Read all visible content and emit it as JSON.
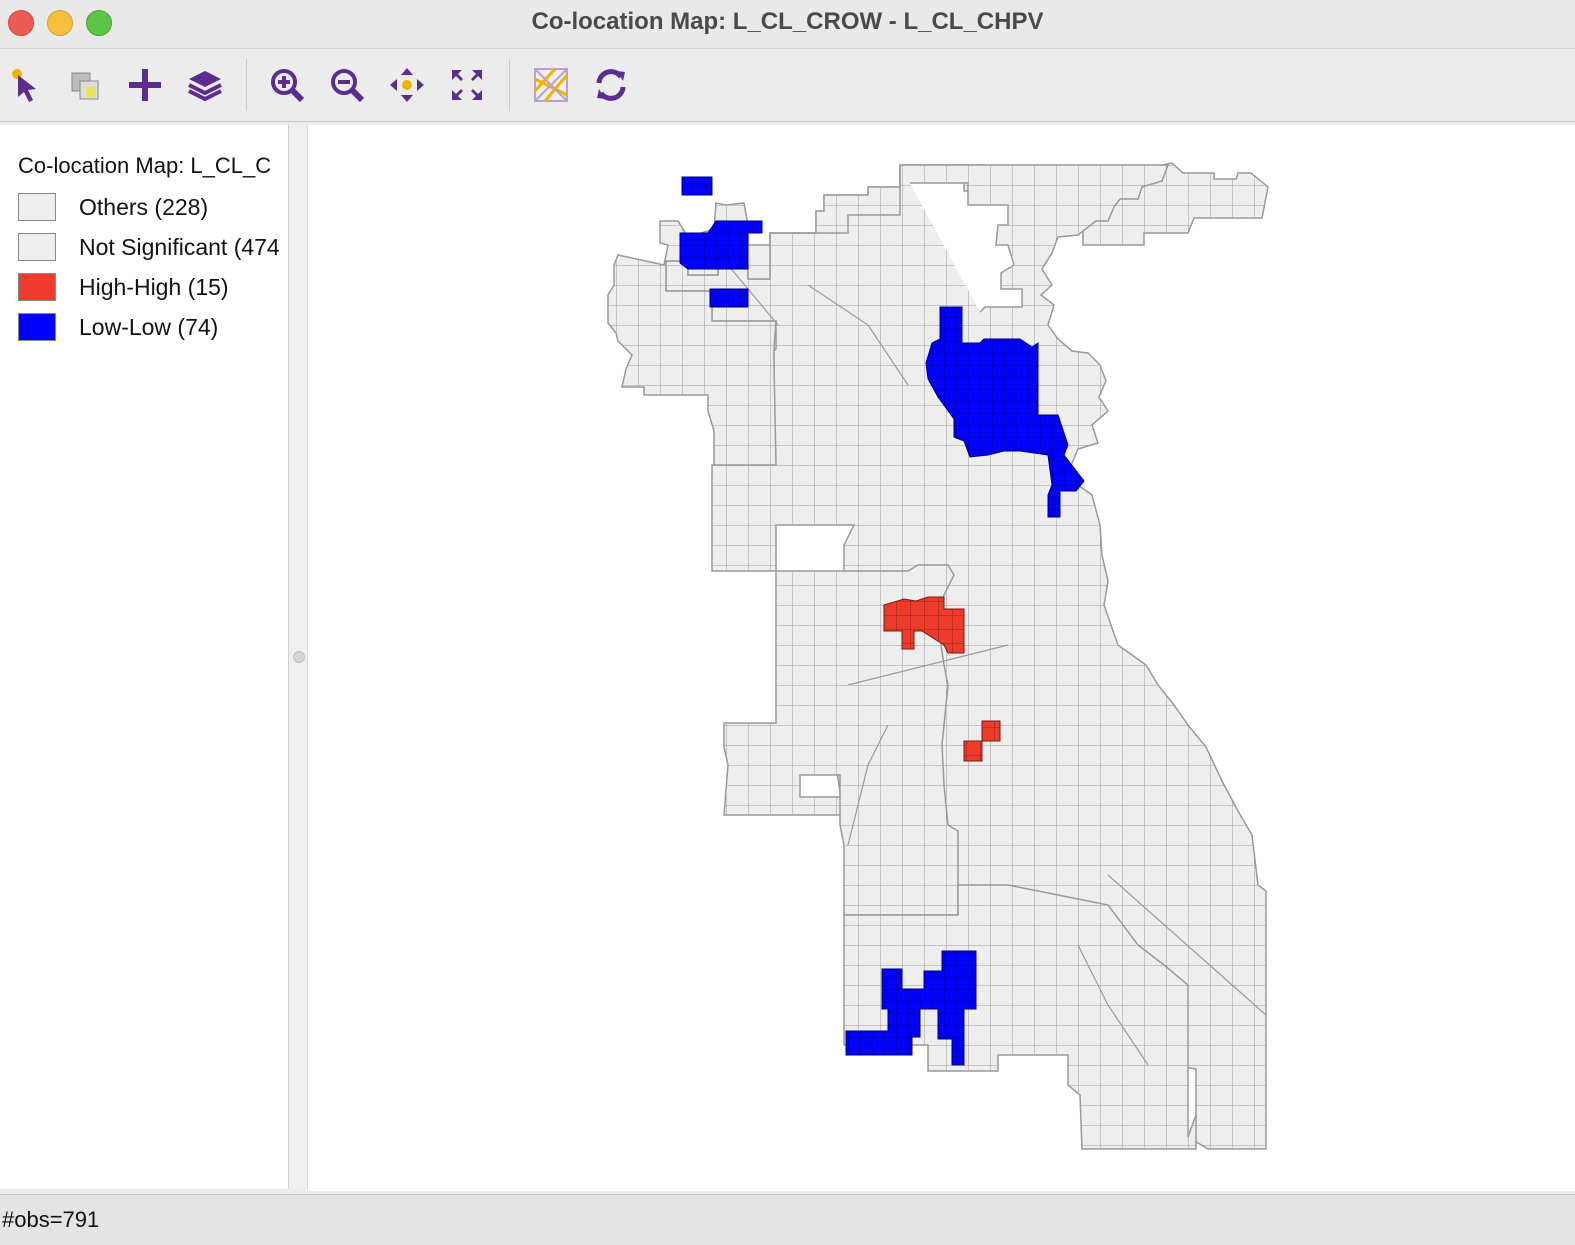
{
  "window": {
    "title": "Co-location Map: L_CL_CROW - L_CL_CHPV"
  },
  "toolbar": {
    "tools": [
      {
        "name": "select-tool",
        "icon": "pointer-icon"
      },
      {
        "name": "selection-shape-tool",
        "icon": "selection-icon"
      },
      {
        "name": "add-layer-tool",
        "icon": "plus-icon"
      },
      {
        "name": "layers-tool",
        "icon": "layers-icon"
      },
      {
        "name": "zoom-in-tool",
        "icon": "zoom-in-icon"
      },
      {
        "name": "zoom-out-tool",
        "icon": "zoom-out-icon"
      },
      {
        "name": "pan-tool",
        "icon": "pan-icon"
      },
      {
        "name": "full-extent-tool",
        "icon": "full-extent-icon"
      },
      {
        "name": "basemap-tool",
        "icon": "basemap-icon"
      },
      {
        "name": "refresh-tool",
        "icon": "refresh-icon"
      }
    ]
  },
  "legend": {
    "title": "Co-location Map: L_CL_C",
    "items": [
      {
        "label": "Others (228)",
        "color": "#eeeeee"
      },
      {
        "label": "Not Significant (474",
        "color": "#eeeeee"
      },
      {
        "label": "High-High (15)",
        "color": "#ef3b2c"
      },
      {
        "label": "Low-Low (74)",
        "color": "#0000ff"
      }
    ]
  },
  "map": {
    "fill_default": "#eeeeee",
    "stroke": "#999999",
    "high_high_color": "#ef3b2c",
    "low_low_color": "#0000ff"
  },
  "status": {
    "text": "#obs=791"
  }
}
